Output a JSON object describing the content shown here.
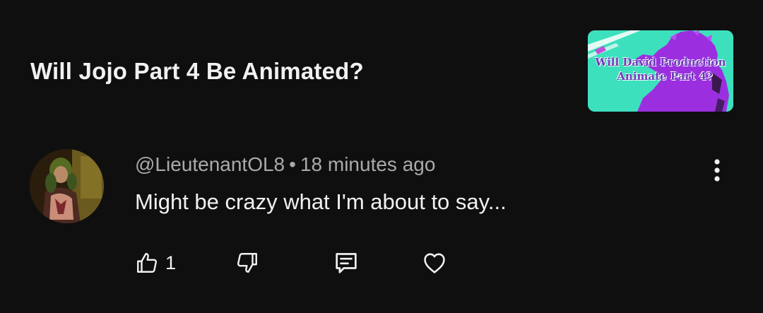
{
  "video": {
    "title": "Will Jojo Part 4 Be Animated?",
    "thumbnail": {
      "text_line1": "Will David Production",
      "text_line2": "Animate Part 4?",
      "background_color": "#3de0bd",
      "silhouette_color": "#9b2fe0"
    }
  },
  "comment": {
    "author": "@LieutenantOL8",
    "separator": "•",
    "time": "18 minutes ago",
    "text": "Might be crazy what I'm about to say...",
    "like_count": "1"
  },
  "icons": {
    "like": "thumbs-up-icon",
    "dislike": "thumbs-down-icon",
    "reply": "comment-icon",
    "heart": "heart-icon",
    "more": "vertical-dots-icon"
  },
  "theme": {
    "background": "#0f0f0f",
    "text_primary": "#f1f1f1",
    "text_secondary": "#aaaaaa"
  }
}
